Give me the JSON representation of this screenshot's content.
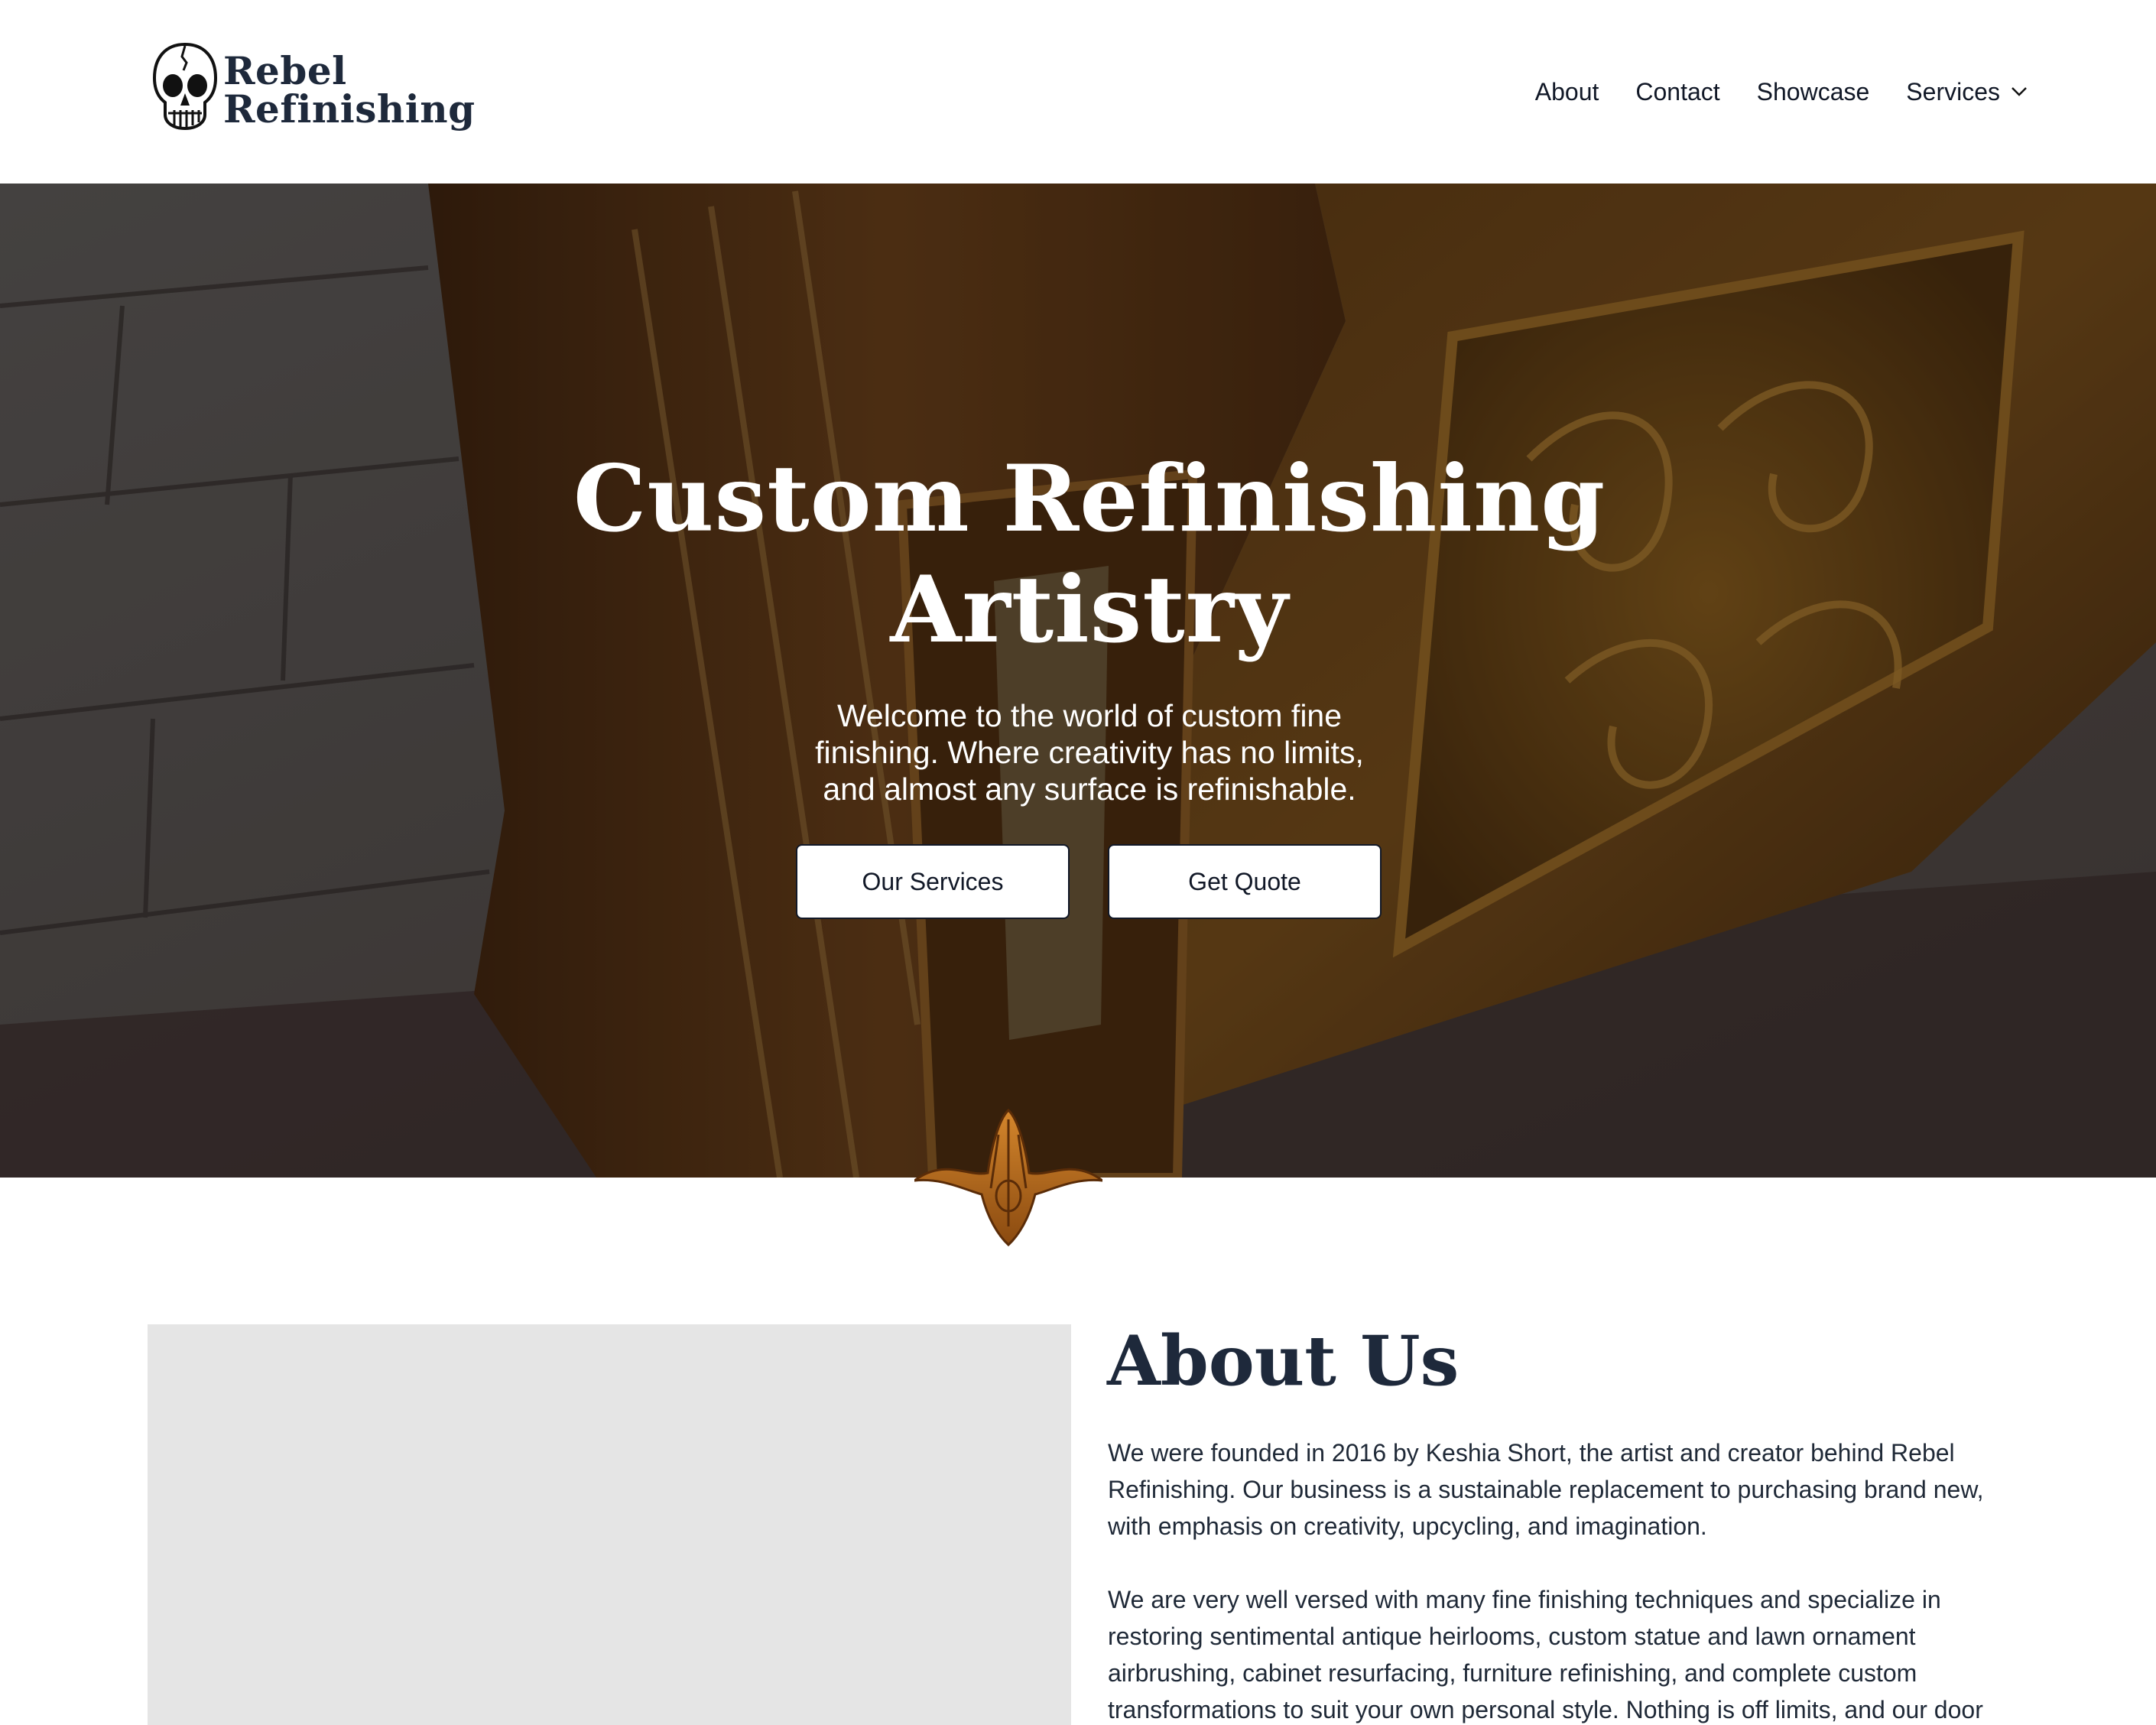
{
  "header": {
    "logo": {
      "line1": "Rebel",
      "line2": "Refinishing",
      "icon": "skull-icon"
    },
    "nav": [
      {
        "label": "About"
      },
      {
        "label": "Contact"
      },
      {
        "label": "Showcase"
      },
      {
        "label": "Services",
        "icon": "chevron-down-icon"
      }
    ]
  },
  "hero": {
    "title_line1": "Custom Refinishing",
    "title_line2": "Artistry",
    "subtitle": "Welcome to the world of custom fine finishing. Where creativity has no limits, and almost any surface is refinishable.",
    "buttons": {
      "services": "Our Services",
      "quote": "Get Quote"
    },
    "background": "carved-wood-cabinet-photo"
  },
  "about": {
    "title": "About Us",
    "paragraph1": "We were founded in 2016 by Keshia Short, the artist and creator behind Rebel Refinishing. Our business is a sustainable replacement to purchasing brand new, with emphasis on creativity, upcycling, and imagination.",
    "paragraph2": "We are very well versed with many fine finishing techniques and specialize in restoring sentimental antique heirlooms, custom statue and lawn ornament airbrushing, cabinet resurfacing, furniture refinishing, and complete custom transformations to suit your own personal style. Nothing is off limits, and our door"
  },
  "colors": {
    "heading": "#1e293b",
    "text": "#1f2937",
    "accent": "#b45309"
  }
}
